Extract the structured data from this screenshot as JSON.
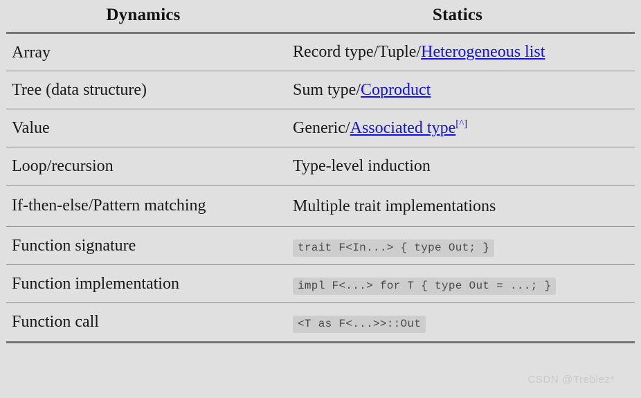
{
  "page": {
    "background_color": "#e0e0e0",
    "text_color": "#1a1a1a",
    "rule_color": "#757575",
    "link_color": "#1313e0",
    "code_background": "#cdcdcd",
    "code_text_color": "#4a4a4a"
  },
  "table": {
    "headers": {
      "dynamics": "Dynamics",
      "statics": "Statics"
    },
    "rows": [
      {
        "dynamics": "Array",
        "statics_prefix": "Record type/Tuple/",
        "statics_link": "Heterogeneous list",
        "statics_suffix": "",
        "statics_sup": "",
        "statics_is_code": false
      },
      {
        "dynamics": "Tree (data structure)",
        "statics_prefix": "Sum type/",
        "statics_link": "Coproduct",
        "statics_suffix": "",
        "statics_sup": "",
        "statics_is_code": false
      },
      {
        "dynamics": "Value",
        "statics_prefix": "Generic/",
        "statics_link": "Associated type",
        "statics_suffix": "",
        "statics_sup": "[^]",
        "statics_is_code": false
      },
      {
        "dynamics": "Loop/recursion",
        "statics_prefix": "Type-level induction",
        "statics_link": "",
        "statics_suffix": "",
        "statics_sup": "",
        "statics_is_code": false
      },
      {
        "dynamics": "If-then-else/Pattern matching",
        "statics_prefix": "Multiple trait implementations",
        "statics_link": "",
        "statics_suffix": "",
        "statics_sup": "",
        "statics_is_code": false
      },
      {
        "dynamics": "Function signature",
        "statics_prefix": "",
        "statics_link": "",
        "statics_suffix": "",
        "statics_sup": "",
        "statics_is_code": true,
        "statics_code": "trait F<In...> { type Out; }"
      },
      {
        "dynamics": "Function implementation",
        "statics_prefix": "",
        "statics_link": "",
        "statics_suffix": "",
        "statics_sup": "",
        "statics_is_code": true,
        "statics_code": "impl F<...> for T { type Out = ...; }"
      },
      {
        "dynamics": "Function call",
        "statics_prefix": "",
        "statics_link": "",
        "statics_suffix": "",
        "statics_sup": "",
        "statics_is_code": true,
        "statics_code": "<T as F<...>>::Out"
      }
    ]
  },
  "watermark": {
    "text": "CSDN @Treblez*"
  }
}
